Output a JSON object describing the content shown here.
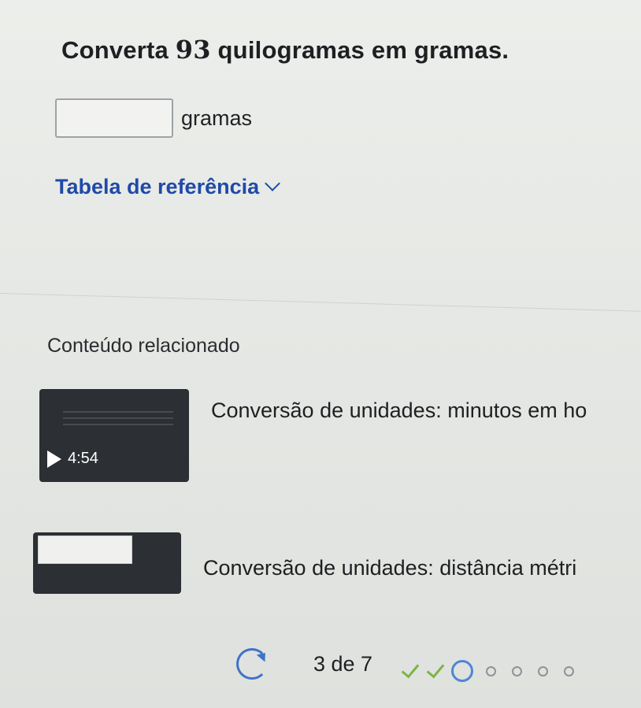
{
  "question": {
    "prefix": "Converta ",
    "number": "93",
    "suffix": " quilogramas em gramas."
  },
  "answer": {
    "value": "",
    "unit": "gramas"
  },
  "reference_table": {
    "label": "Tabela de referência"
  },
  "related": {
    "title": "Conteúdo relacionado",
    "videos": [
      {
        "title": "Conversão de unidades: minutos em ho",
        "duration": "4:54"
      },
      {
        "title": "Conversão de unidades: distância métri",
        "duration": ""
      }
    ]
  },
  "progress": {
    "text": "3 de 7",
    "completed": 2,
    "current": 3,
    "total": 7
  },
  "colors": {
    "link": "#1f4aa8",
    "check": "#7fb34a",
    "current": "#4e86d6"
  }
}
